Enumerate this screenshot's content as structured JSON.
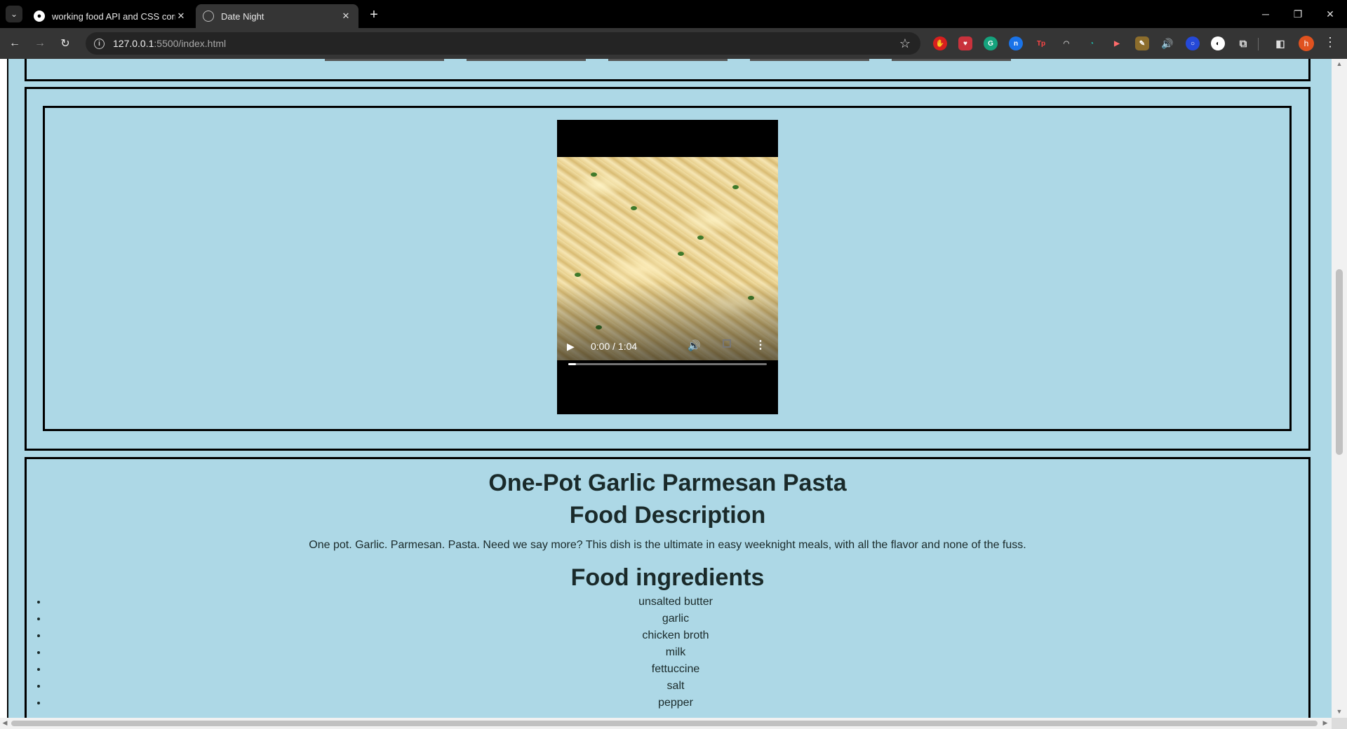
{
  "browser": {
    "tabs": [
      {
        "title": "working food API and CSS corr",
        "favicon": "github-icon",
        "active": false
      },
      {
        "title": "Date Night",
        "favicon": "globe-icon",
        "active": true
      }
    ],
    "url_host": "127.0.0.1",
    "url_rest": ":5500/index.html",
    "profile_initial": "h"
  },
  "video": {
    "time": "0:00 / 1:04",
    "progress": 0.04
  },
  "recipe": {
    "title": "One-Pot Garlic Parmesan Pasta",
    "description_heading": "Food Description",
    "description": "One pot. Garlic. Parmesan. Pasta. Need we say more? This dish is the ultimate in easy weeknight meals, with all the flavor and none of the fuss.",
    "ingredients_heading": "Food ingredients",
    "ingredients": [
      "unsalted butter",
      "garlic",
      "chicken broth",
      "milk",
      "fettuccine",
      "salt",
      "pepper"
    ]
  },
  "colors": {
    "page_background": "#add8e6",
    "border": "#000000"
  }
}
